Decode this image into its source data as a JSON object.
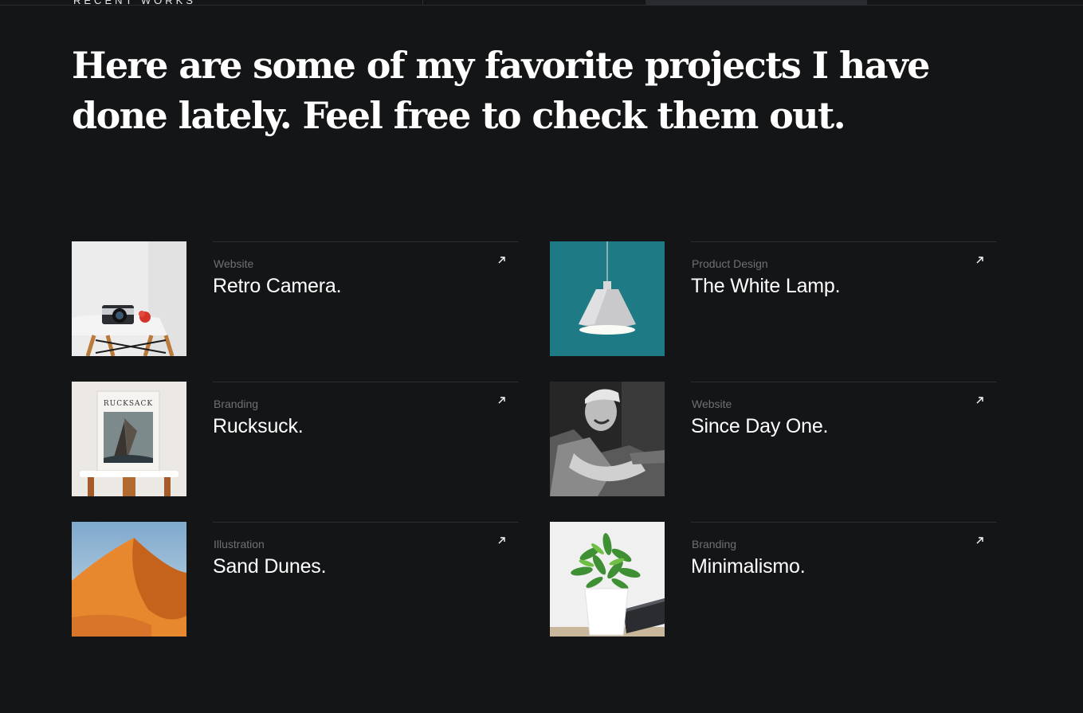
{
  "section": {
    "eyebrow": "RECENT WORKS",
    "headline": "Here are some of my favorite projects I have done lately. Feel free to check them out."
  },
  "projects": [
    {
      "category": "Website",
      "title": "Retro Camera.",
      "image": "camera-on-white-chair"
    },
    {
      "category": "Product Design",
      "title": "The White Lamp.",
      "image": "white-pendant-lamp-teal-wall"
    },
    {
      "category": "Branding",
      "title": "Rucksuck.",
      "image": "rucksack-book-cover",
      "image_text": "RUCKSACK"
    },
    {
      "category": "Website",
      "title": "Since Day One.",
      "image": "man-in-cap-black-and-white"
    },
    {
      "category": "Illustration",
      "title": "Sand Dunes.",
      "image": "orange-sand-dune"
    },
    {
      "category": "Branding",
      "title": "Minimalismo.",
      "image": "potted-plant-white-pot"
    }
  ],
  "icons": {
    "project_link": "arrow-up-right-icon"
  },
  "colors": {
    "background": "#141517",
    "text": "#ffffff",
    "muted": "#6f7075",
    "divider": "#2c2d31"
  }
}
